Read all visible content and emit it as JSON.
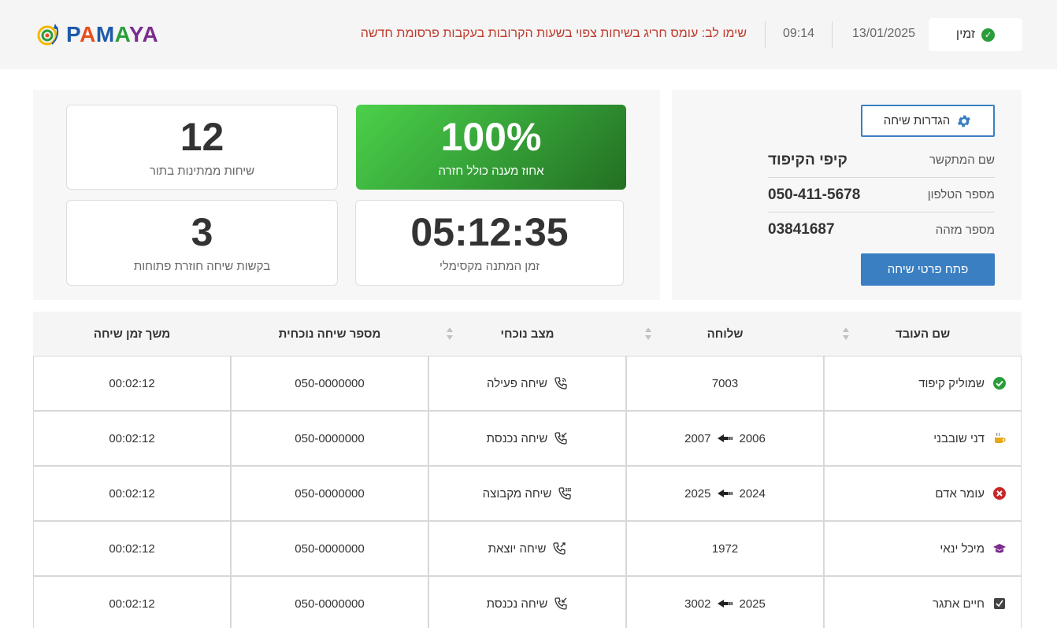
{
  "header": {
    "status_label": "זמין",
    "date": "13/01/2025",
    "time": "09:14",
    "alert": "שימו לב: עומס חריג בשיחות צפוי בשעות הקרובות בעקבות פרסומת חדשה",
    "logo_text": "PAMAYA"
  },
  "caller": {
    "settings_label": "הגדרות שיחה",
    "name_label": "שם המתקשר",
    "name_value": "קיפי הקיפוד",
    "phone_label": "מספר הטלפון",
    "phone_value": "050-411-5678",
    "id_label": "מספר מזהה",
    "id_value": "03841687",
    "open_button": "פתח פרטי שיחה"
  },
  "stats": {
    "answer_rate_value": "100%",
    "answer_rate_label": "אחוז מענה כולל חזרה",
    "queue_value": "12",
    "queue_label": "שיחות ממתינות בתור",
    "max_wait_value": "05:12:35",
    "max_wait_label": "זמן המתנה מקסימלי",
    "callbacks_value": "3",
    "callbacks_label": "בקשות שיחה חוזרת פתוחות"
  },
  "table": {
    "headers": {
      "employee": "שם העובד",
      "extension": "שלוחה",
      "status": "מצב נוכחי",
      "number": "מספר שיחה נוכחית",
      "duration": "משך זמן שיחה"
    },
    "rows": [
      {
        "name": "שמוליק קיפוד",
        "presence_icon": "available-check-icon",
        "ext_from": "7003",
        "ext_to": "",
        "status": "שיחה פעילה",
        "status_icon": "active-call-icon",
        "number": "050-0000000",
        "duration": "00:02:12"
      },
      {
        "name": "דני שובבני",
        "presence_icon": "coffee-break-icon",
        "ext_from": "2006",
        "ext_to": "2007",
        "status": "שיחה נכנסת",
        "status_icon": "incoming-call-icon",
        "number": "050-0000000",
        "duration": "00:02:12"
      },
      {
        "name": "עומר אדם",
        "presence_icon": "unavailable-x-icon",
        "ext_from": "2024",
        "ext_to": "2025",
        "status": "שיחה מקבוצה",
        "status_icon": "group-call-icon",
        "number": "050-0000000",
        "duration": "00:02:12"
      },
      {
        "name": "מיכל ינאי",
        "presence_icon": "training-cap-icon",
        "ext_from": "1972",
        "ext_to": "",
        "status": "שיחה יוצאת",
        "status_icon": "outgoing-call-icon",
        "number": "050-0000000",
        "duration": "00:02:12"
      },
      {
        "name": "חיים אתגר",
        "presence_icon": "task-icon",
        "ext_from": "2025",
        "ext_to": "3002",
        "status": "שיחה נכנסת",
        "status_icon": "incoming-call-icon",
        "number": "050-0000000",
        "duration": "00:02:12"
      }
    ]
  },
  "colors": {
    "accent": "#3a7fc1",
    "alert": "#c0392b",
    "available": "#2a9d3a",
    "unavailable": "#c62828",
    "training": "#7b2d8e"
  }
}
